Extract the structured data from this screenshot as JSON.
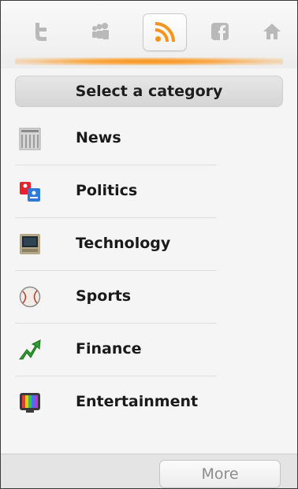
{
  "tabs": [
    {
      "icon": "twitter-icon",
      "active": false
    },
    {
      "icon": "myspace-icon",
      "active": false
    },
    {
      "icon": "rss-icon",
      "active": true
    },
    {
      "icon": "facebook-icon",
      "active": false
    },
    {
      "icon": "home-icon",
      "active": false
    }
  ],
  "header": {
    "title": "Select a category"
  },
  "categories": [
    {
      "label": "News",
      "icon": "newspaper-icon"
    },
    {
      "label": "Politics",
      "icon": "politics-icon"
    },
    {
      "label": "Technology",
      "icon": "computer-icon"
    },
    {
      "label": "Sports",
      "icon": "baseball-icon"
    },
    {
      "label": "Finance",
      "icon": "trend-arrow-icon"
    },
    {
      "label": "Entertainment",
      "icon": "tv-icon"
    }
  ],
  "footer": {
    "more_label": "More"
  },
  "colors": {
    "accent": "#f7941d",
    "inactive_icon": "#b9b9b9",
    "finance_green": "#2e9e2e"
  }
}
